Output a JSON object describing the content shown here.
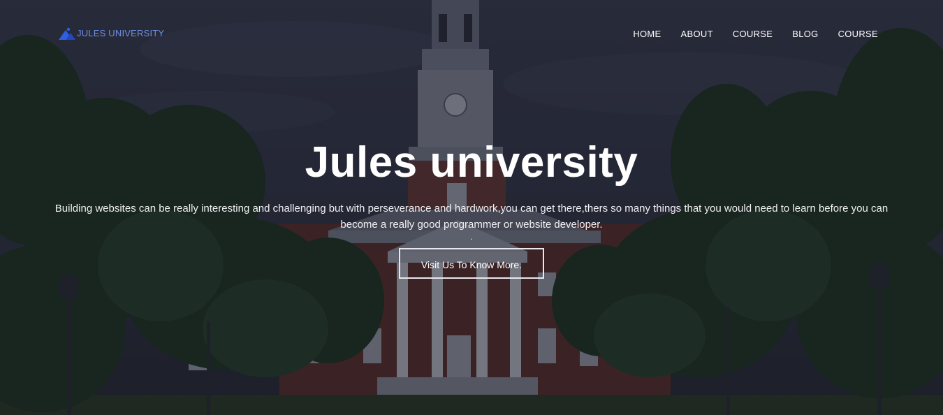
{
  "brand": {
    "name": "JULES UNIVERSITY",
    "logo_icon": "mountain-logo-icon",
    "accent_color": "#2f5fe0"
  },
  "nav": {
    "items": [
      {
        "label": "HOME"
      },
      {
        "label": "ABOUT"
      },
      {
        "label": "COURSE"
      },
      {
        "label": "BLOG"
      },
      {
        "label": "COURSE"
      }
    ]
  },
  "hero": {
    "title": "Jules university",
    "description": "Building websites can be really interesting and challenging but with perseverance and hardwork,you can get there,thers so many things that you would need to learn before you can become a really good programmer or website developer.",
    "dot": ".",
    "cta_label": "Visit Us To Know More."
  }
}
